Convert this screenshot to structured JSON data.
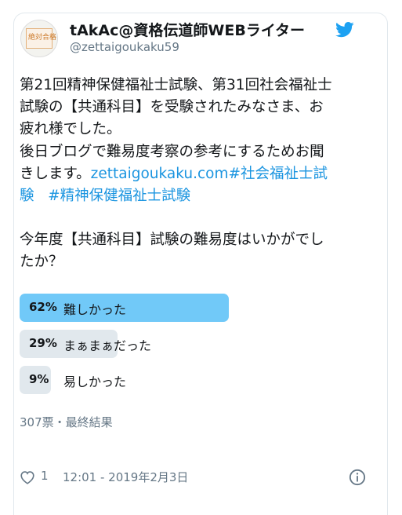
{
  "user": {
    "display_name": "tAkAc@資格伝道師WEBライター",
    "handle": "@zettaigoukaku59",
    "avatar_text": "絶対合格"
  },
  "tweet": {
    "line1": "第21回精神保健福祉士試験、第31回社会福祉士",
    "line2": "試験の【共通科目】を受験されたみなさま、お",
    "line3": "疲れ様でした。",
    "line4": "後日ブログで難易度考察の参考にするためお聞",
    "line5_text": "きします。",
    "line5_link": "zettaigoukaku.com",
    "line5_tag": "#社会福祉士試",
    "line6_tag_cont": "験",
    "line6_tag2": "#精神保健福祉士試験",
    "question1": "今年度【共通科目】試験の難易度はいかがでし",
    "question2": "たか？"
  },
  "poll": {
    "options": [
      {
        "percent_label": "62%",
        "label": "難しかった",
        "value": 0.62,
        "winner": true
      },
      {
        "percent_label": "29%",
        "label": "まぁまぁだった",
        "value": 0.29,
        "winner": false
      },
      {
        "percent_label": "9%",
        "label": "易しかった",
        "value": 0.09,
        "winner": false
      }
    ],
    "summary": "307票・最終結果"
  },
  "footer": {
    "likes": "1",
    "timestamp": "12:01 - 2019年2月3日"
  },
  "colors": {
    "accent": "#1b95e0",
    "winner_bar": "#71c9f8",
    "other_bar": "#e1e8ed",
    "muted_text": "#657786"
  }
}
